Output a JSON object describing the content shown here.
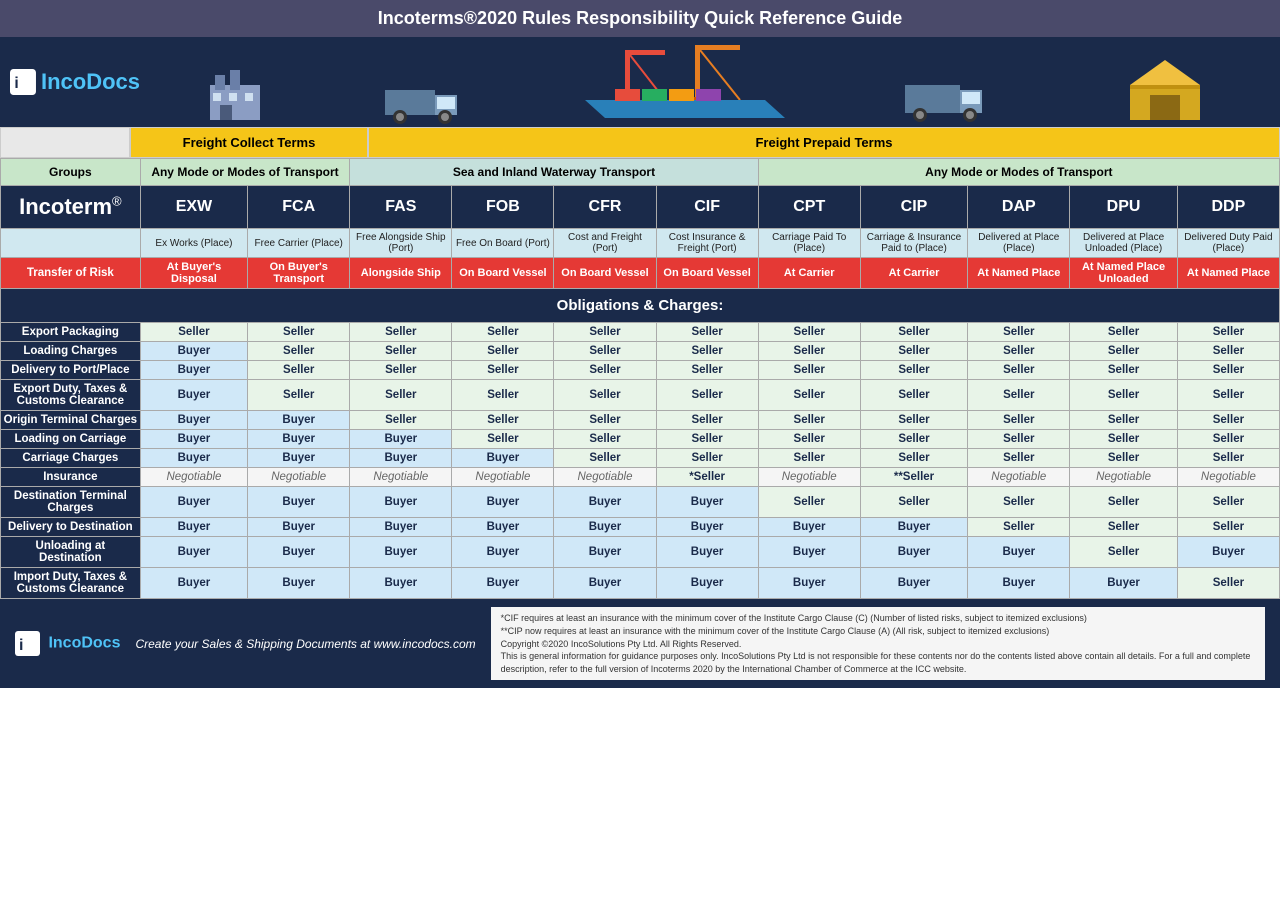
{
  "header": {
    "title": "Incoterms®2020 Rules Responsibility Quick Reference Guide"
  },
  "logo": {
    "text_inco": "Inco",
    "text_docs": "Docs"
  },
  "freight_terms": {
    "collect_label": "Freight Collect Terms",
    "prepaid_label": "Freight Prepaid Terms"
  },
  "transport_modes": {
    "groups_label": "Groups",
    "any_mode_1": "Any Mode or Modes of Transport",
    "sea_inland": "Sea and Inland Waterway Transport",
    "any_mode_2": "Any Mode or Modes of Transport"
  },
  "incoterms": [
    {
      "code": "EXW",
      "name": "Ex Works (Place)"
    },
    {
      "code": "FCA",
      "name": "Free Carrier (Place)"
    },
    {
      "code": "FAS",
      "name": "Free Alongside Ship (Port)"
    },
    {
      "code": "FOB",
      "name": "Free On Board (Port)"
    },
    {
      "code": "CFR",
      "name": "Cost and Freight (Port)"
    },
    {
      "code": "CIF",
      "name": "Cost Insurance & Freight (Port)"
    },
    {
      "code": "CPT",
      "name": "Carriage Paid To (Place)"
    },
    {
      "code": "CIP",
      "name": "Carriage & Insurance Paid to (Place)"
    },
    {
      "code": "DAP",
      "name": "Delivered at Place (Place)"
    },
    {
      "code": "DPU",
      "name": "Delivered at Place Unloaded (Place)"
    },
    {
      "code": "DDP",
      "name": "Delivered Duty Paid (Place)"
    }
  ],
  "incoterm_label": "Incoterm",
  "risk_label": "Transfer of Risk",
  "risks": [
    "At Buyer's Disposal",
    "On Buyer's Transport",
    "Alongside Ship",
    "On Board Vessel",
    "On Board Vessel",
    "On Board Vessel",
    "At Carrier",
    "At Carrier",
    "At Named Place",
    "At Named Place Unloaded",
    "At Named Place"
  ],
  "obligations_header": "Obligations & Charges:",
  "rows": [
    {
      "label": "Export Packaging",
      "values": [
        "Seller",
        "Seller",
        "Seller",
        "Seller",
        "Seller",
        "Seller",
        "Seller",
        "Seller",
        "Seller",
        "Seller",
        "Seller"
      ]
    },
    {
      "label": "Loading Charges",
      "values": [
        "Buyer",
        "Seller",
        "Seller",
        "Seller",
        "Seller",
        "Seller",
        "Seller",
        "Seller",
        "Seller",
        "Seller",
        "Seller"
      ]
    },
    {
      "label": "Delivery to Port/Place",
      "values": [
        "Buyer",
        "Seller",
        "Seller",
        "Seller",
        "Seller",
        "Seller",
        "Seller",
        "Seller",
        "Seller",
        "Seller",
        "Seller"
      ]
    },
    {
      "label": "Export Duty, Taxes & Customs Clearance",
      "values": [
        "Buyer",
        "Seller",
        "Seller",
        "Seller",
        "Seller",
        "Seller",
        "Seller",
        "Seller",
        "Seller",
        "Seller",
        "Seller"
      ]
    },
    {
      "label": "Origin Terminal Charges",
      "values": [
        "Buyer",
        "Buyer",
        "Seller",
        "Seller",
        "Seller",
        "Seller",
        "Seller",
        "Seller",
        "Seller",
        "Seller",
        "Seller"
      ]
    },
    {
      "label": "Loading on Carriage",
      "values": [
        "Buyer",
        "Buyer",
        "Buyer",
        "Seller",
        "Seller",
        "Seller",
        "Seller",
        "Seller",
        "Seller",
        "Seller",
        "Seller"
      ]
    },
    {
      "label": "Carriage Charges",
      "values": [
        "Buyer",
        "Buyer",
        "Buyer",
        "Buyer",
        "Seller",
        "Seller",
        "Seller",
        "Seller",
        "Seller",
        "Seller",
        "Seller"
      ]
    },
    {
      "label": "Insurance",
      "values": [
        "Negotiable",
        "Negotiable",
        "Negotiable",
        "Negotiable",
        "Negotiable",
        "*Seller",
        "Negotiable",
        "**Seller",
        "Negotiable",
        "Negotiable",
        "Negotiable"
      ]
    },
    {
      "label": "Destination Terminal Charges",
      "values": [
        "Buyer",
        "Buyer",
        "Buyer",
        "Buyer",
        "Buyer",
        "Buyer",
        "Seller",
        "Seller",
        "Seller",
        "Seller",
        "Seller"
      ]
    },
    {
      "label": "Delivery to Destination",
      "values": [
        "Buyer",
        "Buyer",
        "Buyer",
        "Buyer",
        "Buyer",
        "Buyer",
        "Buyer",
        "Buyer",
        "Seller",
        "Seller",
        "Seller"
      ]
    },
    {
      "label": "Unloading at Destination",
      "values": [
        "Buyer",
        "Buyer",
        "Buyer",
        "Buyer",
        "Buyer",
        "Buyer",
        "Buyer",
        "Buyer",
        "Buyer",
        "Seller",
        "Buyer"
      ]
    },
    {
      "label": "Import Duty, Taxes & Customs Clearance",
      "values": [
        "Buyer",
        "Buyer",
        "Buyer",
        "Buyer",
        "Buyer",
        "Buyer",
        "Buyer",
        "Buyer",
        "Buyer",
        "Buyer",
        "Seller"
      ]
    }
  ],
  "footer": {
    "logo_inco": "Inco",
    "logo_docs": "Docs",
    "tagline": "Create your Sales & Shipping Documents at www.incodocs.com",
    "note1": "*CIF requires at least an insurance with the minimum cover of the Institute Cargo Clause (C) (Number of listed risks, subject to itemized exclusions)",
    "note2": "**CIP now requires at least an insurance with the minimum cover of the Institute Cargo Clause (A) (All risk, subject to itemized exclusions)",
    "copyright": "Copyright ©2020 IncoSolutions Pty Ltd. All Rights Reserved.",
    "disclaimer": "This is general information for guidance purposes only. IncoSolutions Pty Ltd is not responsible for these contents nor do the contents listed above contain all details. For a full and complete description, refer to the full version of Incoterms 2020 by the International Chamber of Commerce at the ICC website."
  }
}
